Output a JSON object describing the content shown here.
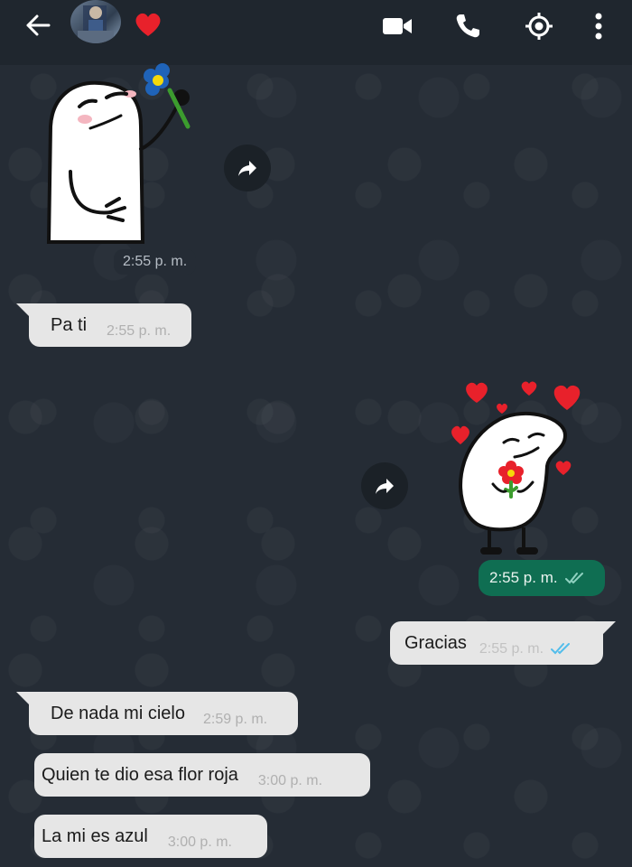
{
  "header": {
    "back_icon": "arrow-left-icon",
    "video_icon": "video-camera-icon",
    "call_icon": "phone-icon",
    "location_icon": "live-location-icon",
    "menu_icon": "more-vertical-icon",
    "heart_icon": "red-heart-icon",
    "heart_color": "#e8212b"
  },
  "messages": {
    "sticker1": {
      "time": "2:55 p. m."
    },
    "msg1": {
      "text": "Pa ti",
      "time": "2:55 p. m."
    },
    "sticker2": {
      "time": "2:55 p. m."
    },
    "msg2": {
      "text": "Gracias",
      "time": "2:55 p. m."
    },
    "msg3": {
      "text": "De nada mi cielo",
      "time": "2:59 p. m."
    },
    "msg4": {
      "text": "Quien te dio esa flor roja",
      "time": "3:00 p. m."
    },
    "msg5": {
      "text": "La mi es azul",
      "time": "3:00 p. m."
    }
  },
  "colors": {
    "header_bg": "#1f262e",
    "chat_bg": "#252c35",
    "bubble_bg": "#e6e6e6",
    "sent_sticker_pill": "#0f6e52",
    "read_ticks": "#53bdeb"
  }
}
